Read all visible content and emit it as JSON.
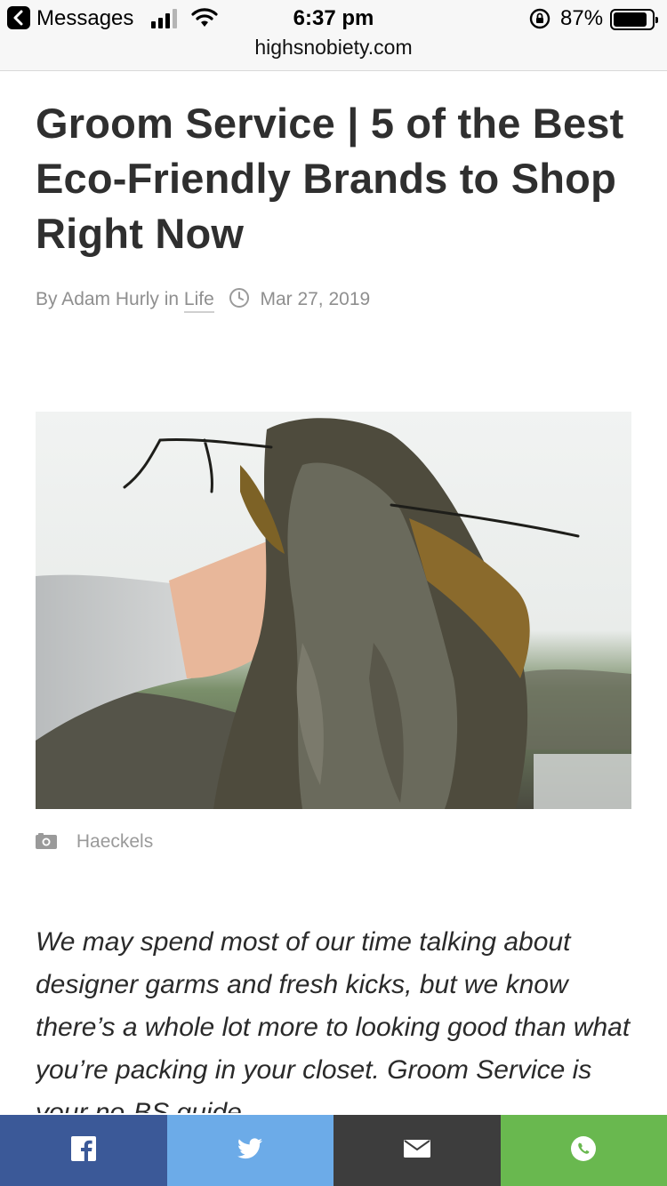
{
  "status_bar": {
    "back_label": "Messages",
    "time": "6:37 pm",
    "battery_percent": "87%",
    "battery_level": 0.87,
    "url": "highsnobiety.com"
  },
  "article": {
    "title": "Groom Service | 5 of the Best Eco-Friendly Brands to Shop Right Now",
    "by_prefix": "By Adam Hurly in",
    "category": "Life",
    "date": "Mar 27, 2019",
    "image_caption": "Haeckels",
    "intro": "We may spend most of our time talking about designer garms and fresh kicks, but we know there’s a whole lot more to looking good than what you’re packing in your closet. Groom Service is your no-BS guide"
  },
  "share_bar": {
    "facebook_icon": "facebook-icon",
    "twitter_icon": "twitter-icon",
    "email_icon": "mail-icon",
    "whatsapp_icon": "whatsapp-icon",
    "colors": {
      "facebook": "#3b5998",
      "twitter": "#6cabe8",
      "email": "#3d3d3d",
      "whatsapp": "#69b84f"
    }
  }
}
